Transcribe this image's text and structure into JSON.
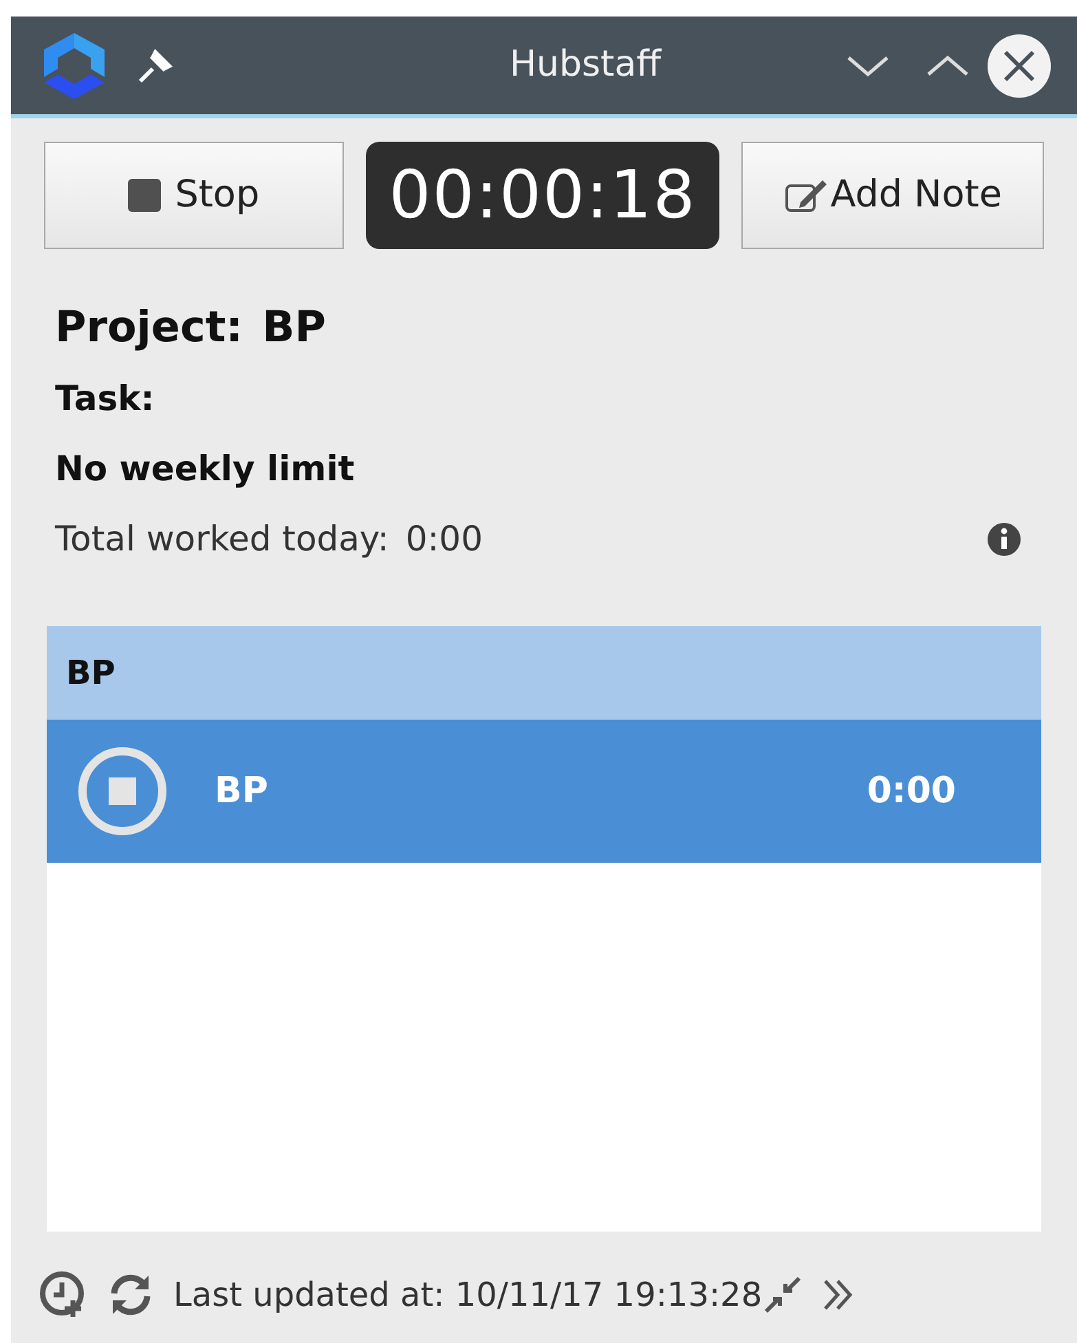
{
  "window": {
    "title": "Hubstaff"
  },
  "controls": {
    "stop": "Stop",
    "timer": "00:00:18",
    "add_note": "Add Note"
  },
  "info": {
    "project_label": "Project:",
    "project": "BP",
    "task_label": "Task:",
    "limit": "No weekly limit",
    "total_label": "Total worked today:",
    "total": "0:00"
  },
  "projects": [
    {
      "name": "BP",
      "tasks": [
        {
          "name": "BP",
          "time": "0:00",
          "selected": true,
          "running": true
        }
      ]
    }
  ],
  "status_bar": {
    "text": "Last updated at: 10/11/17 19:13:28"
  }
}
